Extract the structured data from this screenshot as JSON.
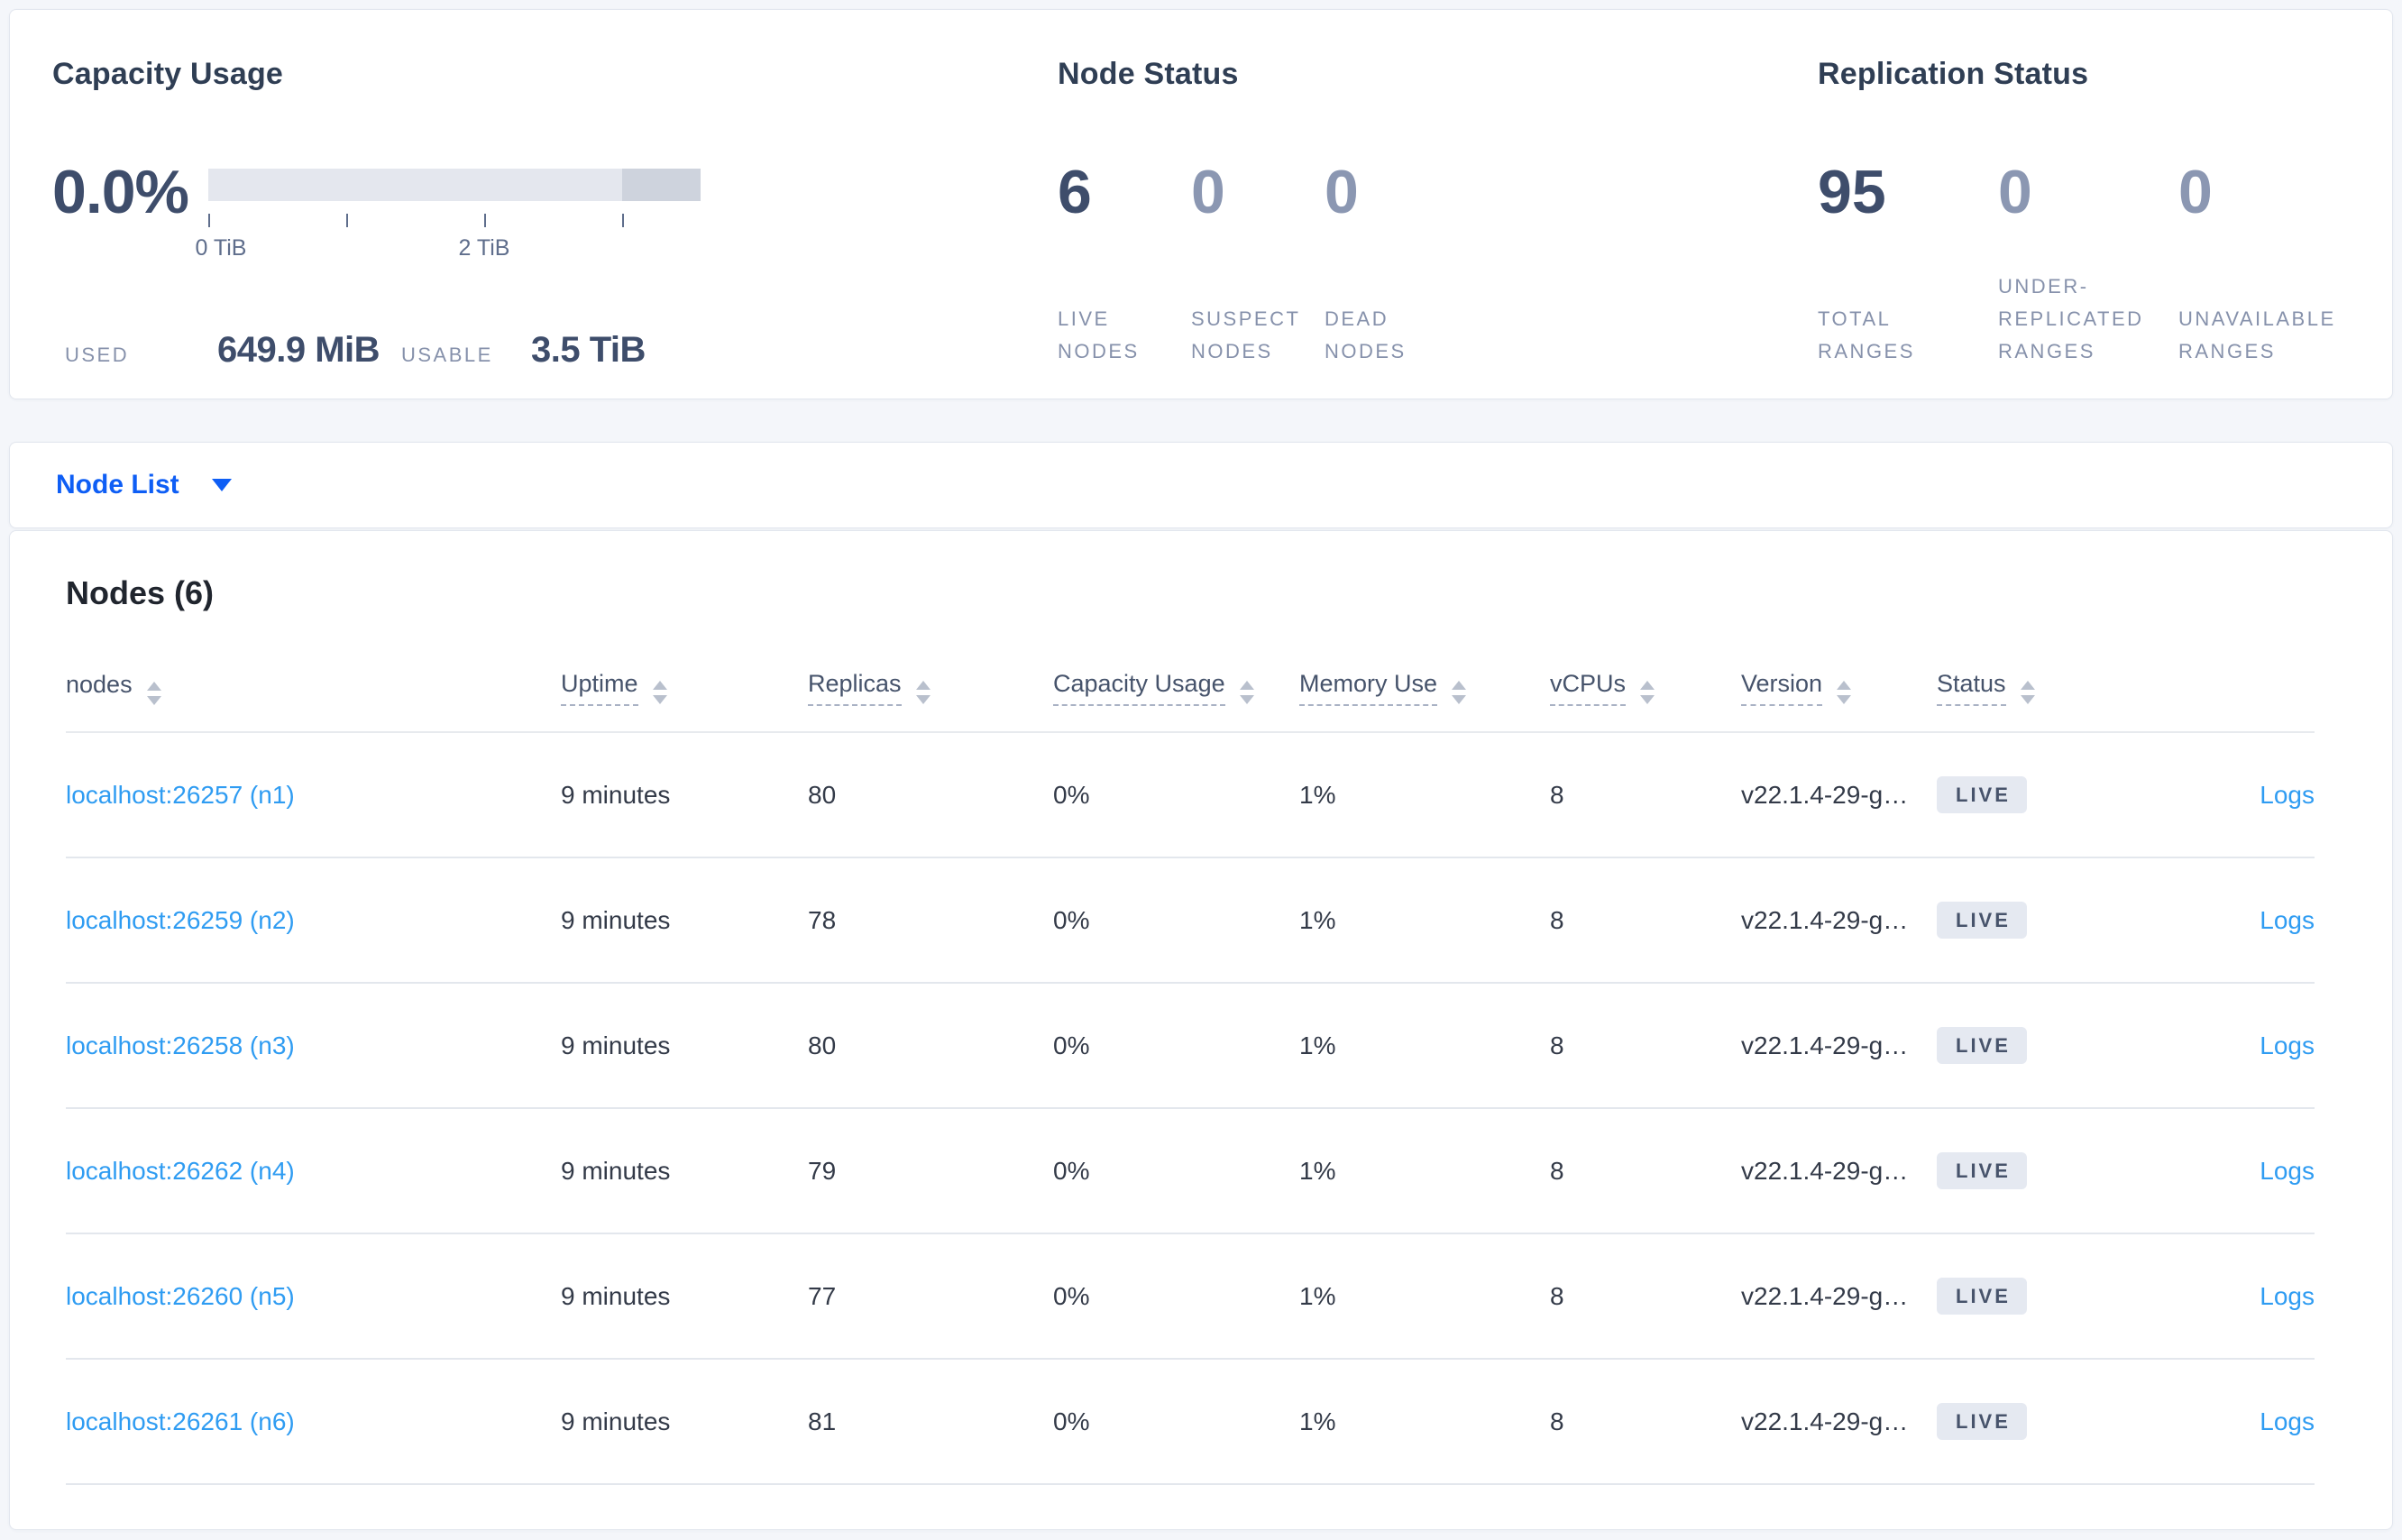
{
  "colors": {
    "accent_blue": "#0e5ef5",
    "link_blue": "#2f9cf2",
    "badge_bg": "#e5e9f1",
    "badge_text": "#47536b",
    "stat_dark": "#3e4d6b",
    "stat_muted": "#8b97b2"
  },
  "summary": {
    "capacity": {
      "title": "Capacity Usage",
      "percent": "0.0%",
      "tick_labels": [
        "0 TiB",
        "2 TiB"
      ],
      "used_label": "USED",
      "used_value": "649.9 MiB",
      "usable_label": "USABLE",
      "usable_value": "3.5 TiB"
    },
    "node_status": {
      "title": "Node Status",
      "stats": [
        {
          "value": "6",
          "label_lines": [
            "LIVE",
            "NODES"
          ]
        },
        {
          "value": "0",
          "label_lines": [
            "SUSPECT",
            "NODES"
          ]
        },
        {
          "value": "0",
          "label_lines": [
            "DEAD",
            "NODES"
          ]
        }
      ]
    },
    "replication": {
      "title": "Replication Status",
      "stats": [
        {
          "value": "95",
          "label_lines": [
            "TOTAL",
            "RANGES"
          ]
        },
        {
          "value": "0",
          "label_lines": [
            "UNDER-",
            "REPLICATED",
            "RANGES"
          ]
        },
        {
          "value": "0",
          "label_lines": [
            "UNAVAILABLE",
            "RANGES"
          ]
        }
      ]
    }
  },
  "view_selector": {
    "label": "Node List"
  },
  "nodes_section": {
    "heading": "Nodes (6)",
    "columns": [
      {
        "label": "nodes"
      },
      {
        "label": "Uptime"
      },
      {
        "label": "Replicas"
      },
      {
        "label": "Capacity Usage"
      },
      {
        "label": "Memory Use"
      },
      {
        "label": "vCPUs"
      },
      {
        "label": "Version"
      },
      {
        "label": "Status"
      }
    ],
    "rows": [
      {
        "address": "localhost:26257 (n1)",
        "uptime": "9 minutes",
        "replicas": "80",
        "capacity": "0%",
        "memory": "1%",
        "vcpus": "8",
        "version": "v22.1.4-29-g…",
        "status": "LIVE",
        "logs": "Logs"
      },
      {
        "address": "localhost:26259 (n2)",
        "uptime": "9 minutes",
        "replicas": "78",
        "capacity": "0%",
        "memory": "1%",
        "vcpus": "8",
        "version": "v22.1.4-29-g…",
        "status": "LIVE",
        "logs": "Logs"
      },
      {
        "address": "localhost:26258 (n3)",
        "uptime": "9 minutes",
        "replicas": "80",
        "capacity": "0%",
        "memory": "1%",
        "vcpus": "8",
        "version": "v22.1.4-29-g…",
        "status": "LIVE",
        "logs": "Logs"
      },
      {
        "address": "localhost:26262 (n4)",
        "uptime": "9 minutes",
        "replicas": "79",
        "capacity": "0%",
        "memory": "1%",
        "vcpus": "8",
        "version": "v22.1.4-29-g…",
        "status": "LIVE",
        "logs": "Logs"
      },
      {
        "address": "localhost:26260 (n5)",
        "uptime": "9 minutes",
        "replicas": "77",
        "capacity": "0%",
        "memory": "1%",
        "vcpus": "8",
        "version": "v22.1.4-29-g…",
        "status": "LIVE",
        "logs": "Logs"
      },
      {
        "address": "localhost:26261 (n6)",
        "uptime": "9 minutes",
        "replicas": "81",
        "capacity": "0%",
        "memory": "1%",
        "vcpus": "8",
        "version": "v22.1.4-29-g…",
        "status": "LIVE",
        "logs": "Logs"
      }
    ]
  }
}
